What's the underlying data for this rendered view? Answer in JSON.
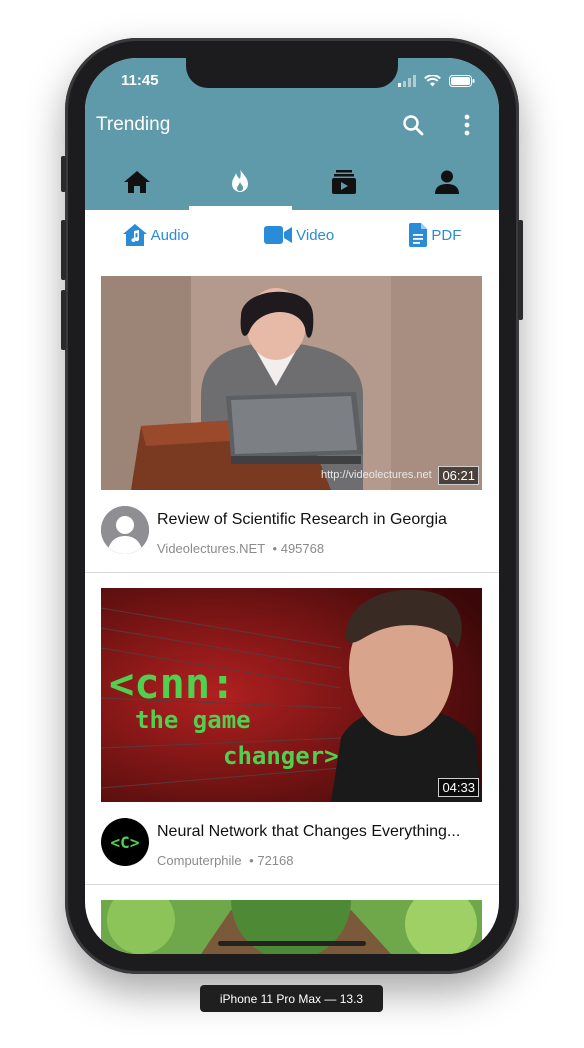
{
  "status_bar": {
    "time": "11:45"
  },
  "header": {
    "title": "Trending"
  },
  "tabs": [
    {
      "icon": "home-icon"
    },
    {
      "icon": "fire-icon",
      "active": true
    },
    {
      "icon": "subscriptions-icon"
    },
    {
      "icon": "person-icon"
    }
  ],
  "filters": [
    {
      "label": "Audio",
      "icon": "audio-house-icon"
    },
    {
      "label": "Video",
      "icon": "video-camera-icon"
    },
    {
      "label": "PDF",
      "icon": "pdf-file-icon"
    }
  ],
  "videos": [
    {
      "title": "Review of Scientific Research in Georgia",
      "channel": "Videolectures.NET",
      "views": "• 495768",
      "duration": "06:21",
      "watermark": "http://videolectures.net"
    },
    {
      "title": "Neural Network that Changes Everything...",
      "channel": "Computerphile",
      "views": "• 72168",
      "duration": "04:33",
      "thumb_text": [
        "<cnn:",
        "the game",
        "changer>"
      ],
      "avatar_text": "<C>"
    }
  ],
  "device_label": "iPhone 11 Pro Max — 13.3",
  "colors": {
    "header": "#5e9aaa",
    "accent": "#2a8cd6"
  }
}
